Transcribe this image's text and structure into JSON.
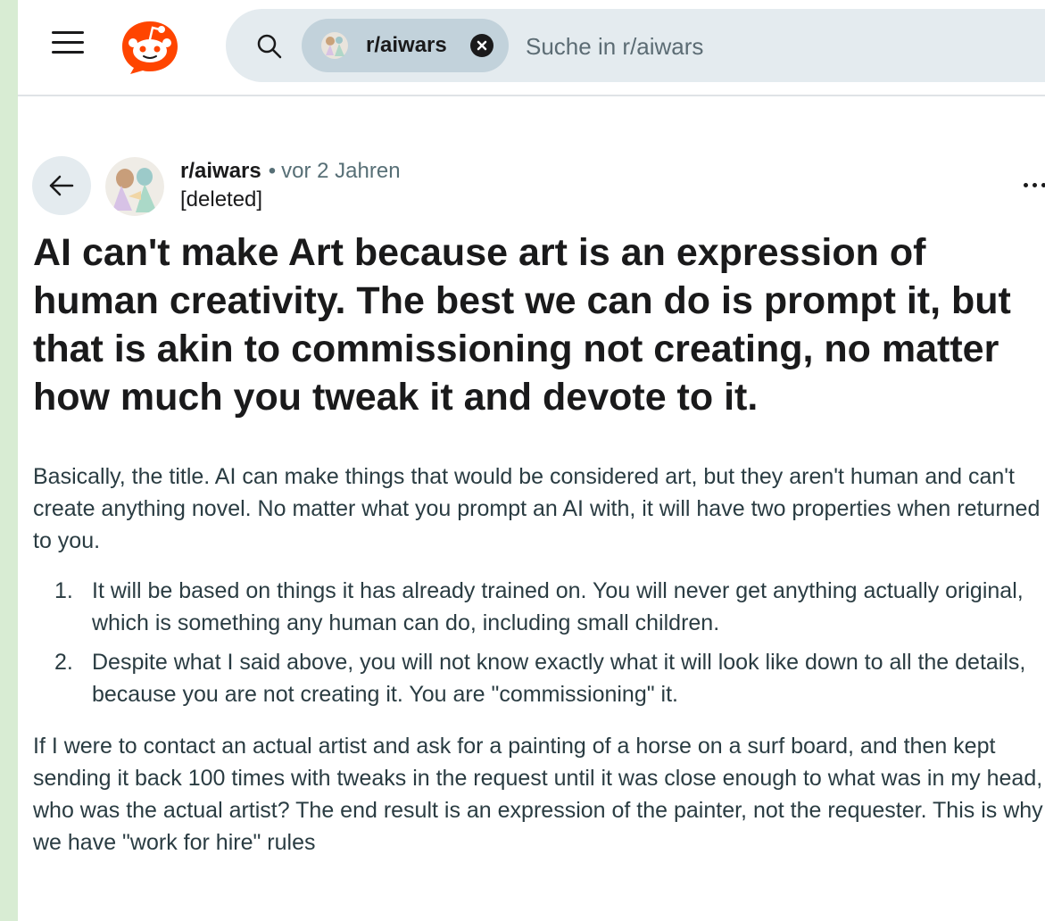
{
  "colors": {
    "brand": "#ff4500",
    "page_background": "#d8ecd3",
    "search_background": "#e4ebef",
    "chip_background": "#c2d2db",
    "text": "#1a1a1b",
    "muted": "#576f76"
  },
  "header": {
    "menu_icon": "hamburger-menu-icon",
    "logo_icon": "reddit-snoo-logo",
    "search": {
      "icon": "search-icon",
      "chip_label": "r/aiwars",
      "chip_close_icon": "close-icon",
      "placeholder": "Suche in r/aiwars"
    }
  },
  "post": {
    "back_icon": "arrow-left-icon",
    "subreddit": "r/aiwars",
    "separator": "•",
    "age": "vor 2 Jahren",
    "author": "[deleted]",
    "more_icon": "more-options-icon",
    "title": "AI can't make Art because art is an expression of human creativity. The best we can do is prompt it, but that is akin to commissioning not creating, no matter how much you tweak it and devote to it.",
    "body": {
      "paragraph1": "Basically, the title. AI can make things that would be considered art, but they aren't human and can't create anything novel. No matter what you prompt an AI with, it will have two properties when returned to you.",
      "list": [
        {
          "number": "1.",
          "text": "It will be based on things it has already trained on. You will never get anything actually original, which is something any human can do, including small children."
        },
        {
          "number": "2.",
          "text": "Despite what I said above, you will not know exactly what it will look like down to all the details, because you are not creating it. You are \"commissioning\" it."
        }
      ],
      "paragraph2": "If I were to contact an actual artist and ask for a painting of a horse on a surf board, and then kept sending it back 100 times with tweaks in the request until it was close enough to what was in my head, who was the actual artist? The end result is an expression of the painter, not the requester. This is why we have \"work for hire\" rules"
    }
  }
}
